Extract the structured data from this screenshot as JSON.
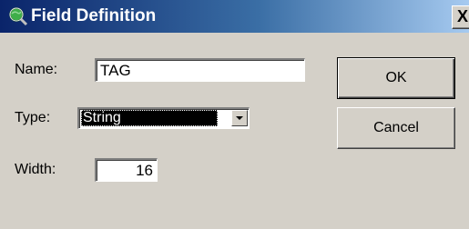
{
  "window": {
    "title": "Field Definition",
    "close_label": "X"
  },
  "form": {
    "name_label": "Name:",
    "name_value": "TAG",
    "type_label": "Type:",
    "type_value": "String",
    "width_label": "Width:",
    "width_value": "16"
  },
  "buttons": {
    "ok_label": "OK",
    "cancel_label": "Cancel"
  },
  "icons": {
    "title_icon": "globe-magnifier-icon",
    "dropdown_icon": "chevron-down-icon"
  },
  "colors": {
    "titlebar_start": "#0a246a",
    "titlebar_end": "#a6caf0",
    "face": "#d4d0c8",
    "selection": "#000000"
  }
}
